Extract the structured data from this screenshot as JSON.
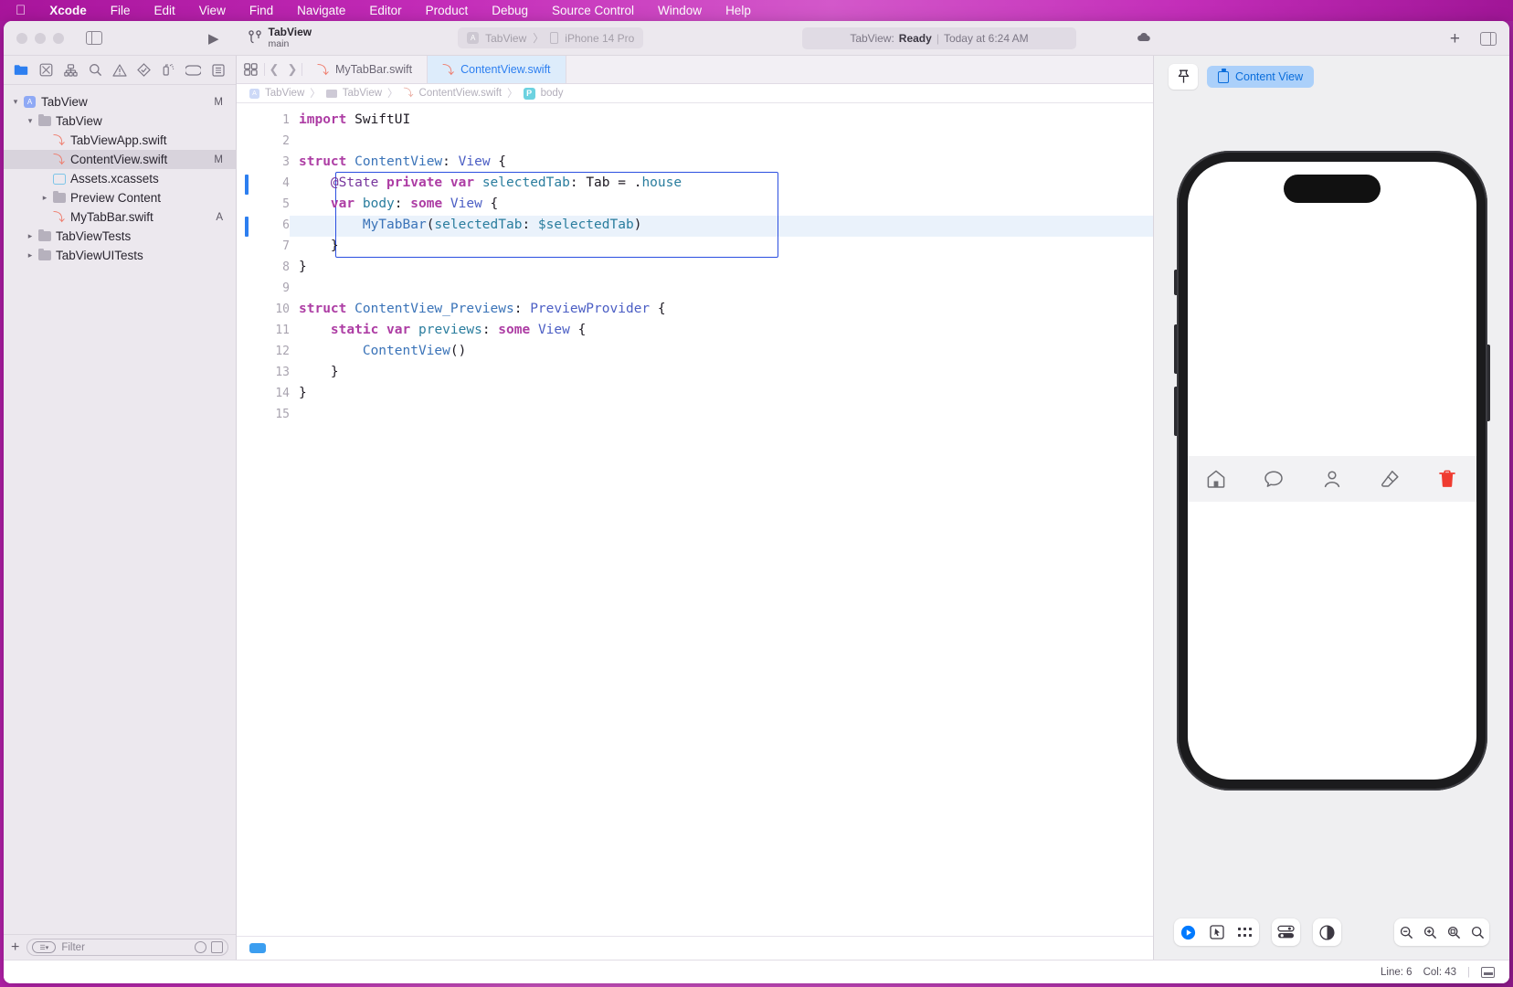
{
  "menubar": {
    "apple_icon": "apple-icon",
    "items": [
      {
        "label": "Xcode",
        "bold": true
      },
      {
        "label": "File"
      },
      {
        "label": "Edit"
      },
      {
        "label": "View"
      },
      {
        "label": "Find"
      },
      {
        "label": "Navigate"
      },
      {
        "label": "Editor"
      },
      {
        "label": "Product"
      },
      {
        "label": "Debug"
      },
      {
        "label": "Source Control"
      },
      {
        "label": "Window"
      },
      {
        "label": "Help"
      }
    ]
  },
  "toolbar": {
    "scheme_name": "TabView",
    "branch_name": "main",
    "destination_project": "TabView",
    "destination_device": "iPhone 14 Pro",
    "destination_separator": "〉",
    "activity_prefix": "TabView:",
    "activity_status": "Ready",
    "activity_sep": "|",
    "activity_time": "Today at 6:24 AM",
    "run_icon": "run-play-icon",
    "add_icon": "add-plus-icon",
    "sidebar_toggle_icon": "toggle-navigator-icon",
    "inspector_toggle_icon": "toggle-inspector-icon",
    "cloud_icon": "cloud-status-icon"
  },
  "navigator": {
    "tabs": [
      {
        "name": "project-navigator",
        "icon": "folder-icon",
        "selected": true
      },
      {
        "name": "source-control-navigator",
        "icon": "source-control-icon",
        "selected": false
      },
      {
        "name": "symbol-navigator",
        "icon": "hierarchy-icon",
        "selected": false
      },
      {
        "name": "find-navigator",
        "icon": "search-icon",
        "selected": false
      },
      {
        "name": "issue-navigator",
        "icon": "warning-triangle-icon",
        "selected": false
      },
      {
        "name": "test-navigator",
        "icon": "diamond-icon",
        "selected": false
      },
      {
        "name": "debug-navigator",
        "icon": "debug-spray-icon",
        "selected": false
      },
      {
        "name": "breakpoint-navigator",
        "icon": "tag-icon",
        "selected": false
      },
      {
        "name": "report-navigator",
        "icon": "report-list-icon",
        "selected": false
      }
    ],
    "tree": [
      {
        "label": "TabView",
        "icon": "project-icon",
        "indent": 0,
        "disclosure": "down",
        "badge": "M",
        "selected": false
      },
      {
        "label": "TabView",
        "icon": "folder-icon",
        "indent": 1,
        "disclosure": "down",
        "badge": "",
        "selected": false
      },
      {
        "label": "TabViewApp.swift",
        "icon": "swift-file-icon",
        "indent": 2,
        "disclosure": "",
        "badge": "",
        "selected": false
      },
      {
        "label": "ContentView.swift",
        "icon": "swift-file-icon",
        "indent": 2,
        "disclosure": "",
        "badge": "M",
        "selected": true
      },
      {
        "label": "Assets.xcassets",
        "icon": "assets-icon",
        "indent": 2,
        "disclosure": "",
        "badge": "",
        "selected": false
      },
      {
        "label": "Preview Content",
        "icon": "folder-icon",
        "indent": 2,
        "disclosure": "right",
        "badge": "",
        "selected": false
      },
      {
        "label": "MyTabBar.swift",
        "icon": "swift-file-icon",
        "indent": 2,
        "disclosure": "",
        "badge": "A",
        "selected": false
      },
      {
        "label": "TabViewTests",
        "icon": "folder-icon",
        "indent": 1,
        "disclosure": "right",
        "badge": "",
        "selected": false
      },
      {
        "label": "TabViewUITests",
        "icon": "folder-icon",
        "indent": 1,
        "disclosure": "right",
        "badge": "",
        "selected": false
      }
    ],
    "filter_placeholder": "Filter",
    "add_label": "+"
  },
  "editor": {
    "tabs": [
      {
        "label": "MyTabBar.swift",
        "icon": "swift-file-icon",
        "active": false
      },
      {
        "label": "ContentView.swift",
        "icon": "swift-file-icon",
        "active": true
      }
    ],
    "breadcrumb": [
      {
        "label": "TabView",
        "icon": "project-icon"
      },
      {
        "label": "TabView",
        "icon": "folder-icon"
      },
      {
        "label": "ContentView.swift",
        "icon": "swift-file-icon"
      },
      {
        "label": "body",
        "icon": "property-icon"
      }
    ],
    "breadcrumb_sep": "〉",
    "lines": [
      {
        "n": 1,
        "tokens": [
          {
            "t": "import",
            "c": "kw"
          },
          {
            "t": " SwiftUI",
            "c": "plain"
          }
        ]
      },
      {
        "n": 2,
        "tokens": []
      },
      {
        "n": 3,
        "tokens": [
          {
            "t": "struct",
            "c": "kw"
          },
          {
            "t": " ",
            "c": "plain"
          },
          {
            "t": "ContentView",
            "c": "typ"
          },
          {
            "t": ": ",
            "c": "plain"
          },
          {
            "t": "View",
            "c": "typ2"
          },
          {
            "t": " {",
            "c": "plain"
          }
        ]
      },
      {
        "n": 4,
        "tokens": [
          {
            "t": "    ",
            "c": "plain"
          },
          {
            "t": "@State",
            "c": "attr"
          },
          {
            "t": " ",
            "c": "plain"
          },
          {
            "t": "private",
            "c": "kw"
          },
          {
            "t": " ",
            "c": "plain"
          },
          {
            "t": "var",
            "c": "kw"
          },
          {
            "t": " ",
            "c": "plain"
          },
          {
            "t": "selectedTab",
            "c": "prop"
          },
          {
            "t": ": Tab = .",
            "c": "plain"
          },
          {
            "t": "house",
            "c": "prop"
          }
        ]
      },
      {
        "n": 5,
        "tokens": [
          {
            "t": "    ",
            "c": "plain"
          },
          {
            "t": "var",
            "c": "kw"
          },
          {
            "t": " ",
            "c": "plain"
          },
          {
            "t": "body",
            "c": "prop"
          },
          {
            "t": ": ",
            "c": "plain"
          },
          {
            "t": "some",
            "c": "kw"
          },
          {
            "t": " ",
            "c": "plain"
          },
          {
            "t": "View",
            "c": "typ2"
          },
          {
            "t": " {",
            "c": "plain"
          }
        ]
      },
      {
        "n": 6,
        "tokens": [
          {
            "t": "        ",
            "c": "plain"
          },
          {
            "t": "MyTabBar",
            "c": "typ"
          },
          {
            "t": "(",
            "c": "plain"
          },
          {
            "t": "selectedTab",
            "c": "prop"
          },
          {
            "t": ": ",
            "c": "plain"
          },
          {
            "t": "$selectedTab",
            "c": "prop"
          },
          {
            "t": ")",
            "c": "plain"
          }
        ]
      },
      {
        "n": 7,
        "tokens": [
          {
            "t": "    }",
            "c": "plain"
          }
        ]
      },
      {
        "n": 8,
        "tokens": [
          {
            "t": "}",
            "c": "plain"
          }
        ]
      },
      {
        "n": 9,
        "tokens": []
      },
      {
        "n": 10,
        "tokens": [
          {
            "t": "struct",
            "c": "kw"
          },
          {
            "t": " ",
            "c": "plain"
          },
          {
            "t": "ContentView_Previews",
            "c": "typ"
          },
          {
            "t": ": ",
            "c": "plain"
          },
          {
            "t": "PreviewProvider",
            "c": "typ2"
          },
          {
            "t": " {",
            "c": "plain"
          }
        ]
      },
      {
        "n": 11,
        "tokens": [
          {
            "t": "    ",
            "c": "plain"
          },
          {
            "t": "static",
            "c": "kw"
          },
          {
            "t": " ",
            "c": "plain"
          },
          {
            "t": "var",
            "c": "kw"
          },
          {
            "t": " ",
            "c": "plain"
          },
          {
            "t": "previews",
            "c": "prop"
          },
          {
            "t": ": ",
            "c": "plain"
          },
          {
            "t": "some",
            "c": "kw"
          },
          {
            "t": " ",
            "c": "plain"
          },
          {
            "t": "View",
            "c": "typ2"
          },
          {
            "t": " {",
            "c": "plain"
          }
        ]
      },
      {
        "n": 12,
        "tokens": [
          {
            "t": "        ",
            "c": "plain"
          },
          {
            "t": "ContentView",
            "c": "typ"
          },
          {
            "t": "()",
            "c": "plain"
          }
        ]
      },
      {
        "n": 13,
        "tokens": [
          {
            "t": "    }",
            "c": "plain"
          }
        ]
      },
      {
        "n": 14,
        "tokens": [
          {
            "t": "}",
            "c": "plain"
          }
        ]
      },
      {
        "n": 15,
        "tokens": []
      }
    ],
    "highlighted_line": 6,
    "change_bar_lines": [
      4,
      6
    ],
    "selection_box_lines": [
      4,
      8
    ],
    "selection_color": "#2b4fe0"
  },
  "canvas": {
    "pin_icon": "pin-icon",
    "preview_chip_label": "Content View",
    "preview_chip_icon": "preview-view-icon",
    "phone_model": "iPhone 14 Pro",
    "tab_bar_items": [
      {
        "name": "tab-house",
        "icon": "house-icon",
        "active": false
      },
      {
        "name": "tab-message",
        "icon": "message-bubble-icon",
        "active": false
      },
      {
        "name": "tab-person",
        "icon": "person-icon",
        "active": false
      },
      {
        "name": "tab-eraser",
        "icon": "eraser-icon",
        "active": false
      },
      {
        "name": "tab-trash",
        "icon": "trash-icon",
        "active": true
      }
    ],
    "active_tab_color": "#ef3b30",
    "controls": [
      {
        "name": "live-preview-button",
        "icon": "play-circle-icon"
      },
      {
        "name": "selectable-preview-button",
        "icon": "cursor-box-icon"
      },
      {
        "name": "variants-button",
        "icon": "grid-dots-icon"
      },
      {
        "name": "device-settings-button",
        "icon": "device-settings-icon"
      },
      {
        "name": "appearance-button",
        "icon": "half-circle-icon"
      }
    ],
    "zoom_controls": [
      {
        "name": "zoom-out-button",
        "icon": "magnifier-minus-icon"
      },
      {
        "name": "zoom-in-button",
        "icon": "magnifier-plus-icon"
      },
      {
        "name": "zoom-fit-button",
        "icon": "magnifier-fit-icon"
      },
      {
        "name": "zoom-100-button",
        "icon": "magnifier-actual-icon"
      }
    ]
  },
  "statusbar": {
    "line_label": "Line: 6",
    "col_label": "Col: 43",
    "sep": "|",
    "panel_icon": "toggle-debug-area-icon"
  }
}
